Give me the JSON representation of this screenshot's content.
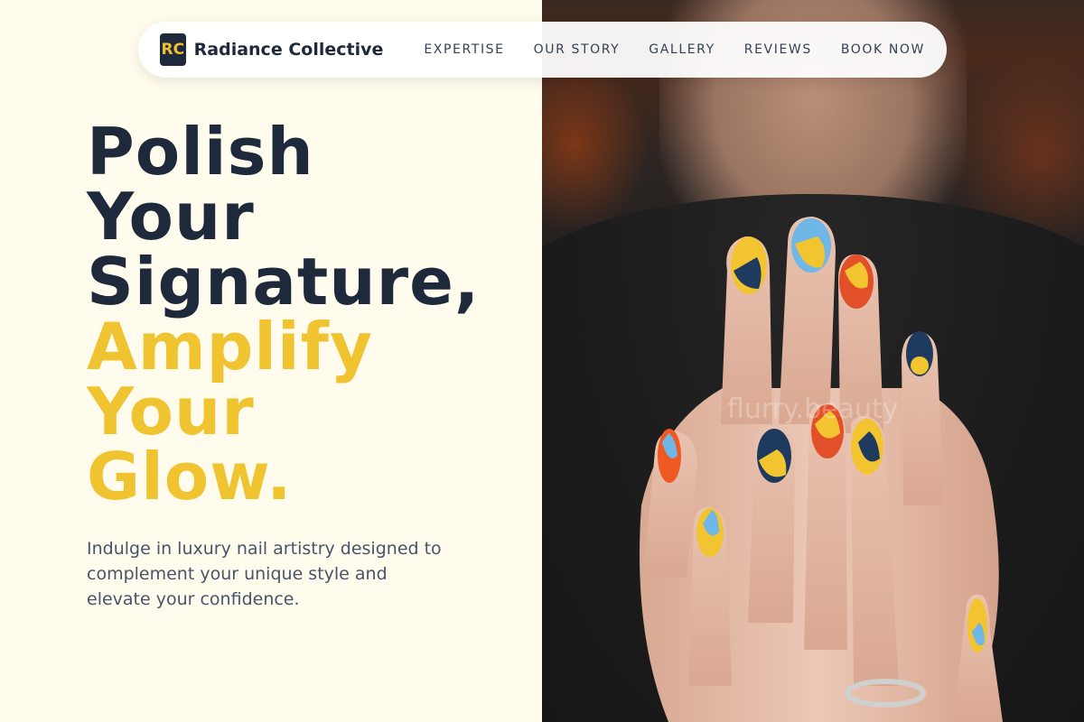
{
  "nav": {
    "logo_text": "RC",
    "brand_name": "Radiance Collective",
    "links": [
      {
        "label": "EXPERTISE"
      },
      {
        "label": "OUR STORY"
      },
      {
        "label": "GALLERY"
      },
      {
        "label": "REVIEWS"
      },
      {
        "label": "BOOK NOW"
      }
    ]
  },
  "hero": {
    "headline_lines_dark": [
      "Polish",
      "Your",
      "Signature,"
    ],
    "headline_lines_gold": [
      "Amplify",
      "Your",
      "Glow."
    ],
    "subtext": "Indulge in luxury nail artistry designed to complement your unique style and elevate your confidence."
  },
  "image": {
    "watermark": "flurry.beauty"
  },
  "colors": {
    "accent_gold": "#f0c330",
    "navy": "#1e293b",
    "background": "#fffcee"
  }
}
